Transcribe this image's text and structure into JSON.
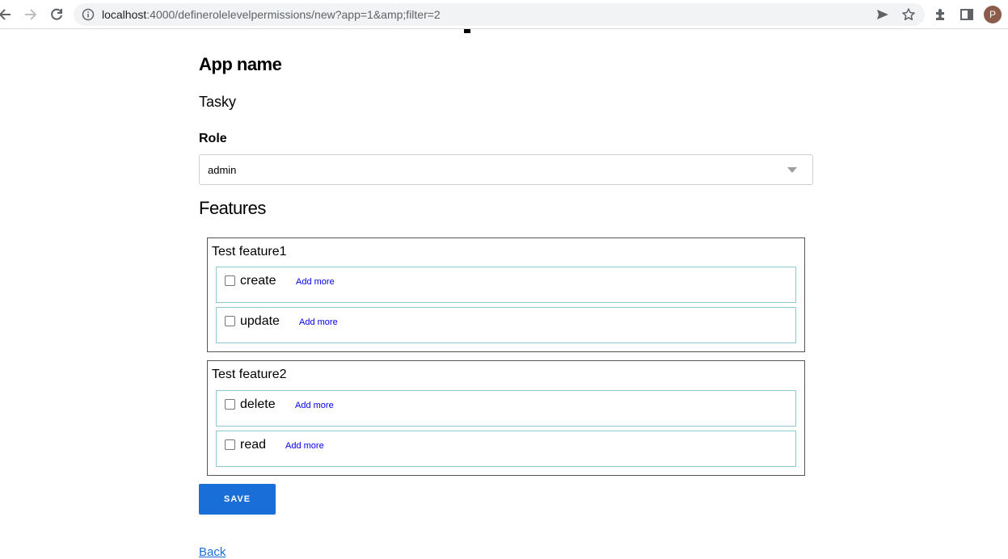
{
  "browser": {
    "url_host": "localhost",
    "url_rest": ":4000/definerolelevelpermissions/new?app=1&amp;filter=2",
    "avatar_letter": "P"
  },
  "page": {
    "app_label": "App name",
    "app_value": "Tasky",
    "role_label": "Role",
    "role_selected": "admin",
    "features_title": "Features",
    "features": [
      {
        "name": "Test feature1",
        "permissions": [
          {
            "name": "create",
            "add_more": "Add more",
            "checked": false
          },
          {
            "name": "update",
            "add_more": "Add more",
            "checked": false
          }
        ]
      },
      {
        "name": "Test feature2",
        "permissions": [
          {
            "name": "delete",
            "add_more": "Add more",
            "checked": false
          },
          {
            "name": "read",
            "add_more": "Add more",
            "checked": false
          }
        ]
      }
    ],
    "save_label": "SAVE",
    "back_label": "Back"
  },
  "colors": {
    "primary": "#1a6ed8",
    "link": "#0000ee",
    "row_border": "#8fc7d3"
  },
  "icons": [
    "back-arrow-icon",
    "forward-arrow-icon",
    "reload-icon",
    "info-icon",
    "send-icon",
    "star-icon",
    "extensions-icon",
    "side-panel-icon"
  ]
}
